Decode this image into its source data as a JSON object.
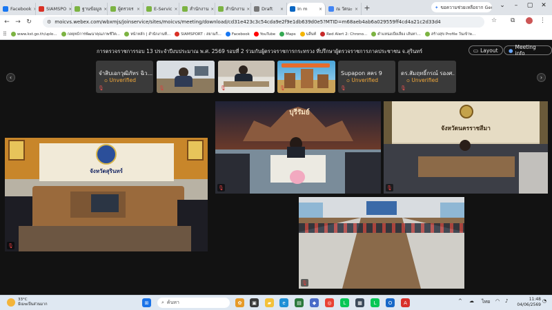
{
  "browser": {
    "tabs": [
      {
        "label": "Facebook",
        "color": "#1877f2",
        "active": false
      },
      {
        "label": "SIAMSPO",
        "color": "#d93025",
        "active": false
      },
      {
        "label": "ฐานข้อมูล",
        "color": "#7cb342",
        "active": false
      },
      {
        "label": "ผู้ตรวจร",
        "color": "#7cb342",
        "active": false
      },
      {
        "label": "E-Servic",
        "color": "#7cb342",
        "active": false
      },
      {
        "label": "สำนักงาน",
        "color": "#7cb342",
        "active": false
      },
      {
        "label": "สำนักงาน",
        "color": "#7cb342",
        "active": false
      },
      {
        "label": "Draft",
        "color": "#777777",
        "active": false
      },
      {
        "label": "In m",
        "color": "#0a66c2",
        "active": true
      },
      {
        "label": "ณ วัดนะ",
        "color": "#4285f4",
        "active": false
      }
    ],
    "gemini_label": "ขอความช่วยเหลือจาก Gemini",
    "url": "moicvs.webex.com/wbxmjs/joinservice/sites/moicvs/meeting/download/cd31e423c3c54cda9e2f9e1db639d0e5?MTID=m68aeb4ab6a029559ff4cd4a21c2d33d4",
    "bookmarks": [
      {
        "label": "www.kst.go.th/uplo...",
        "color": "#7cb342"
      },
      {
        "label": "กลยุทธ์การพัฒนาคุณภาพชีวิต...",
        "color": "#7cb342"
      },
      {
        "label": "หน้าหลัก | สำนักงานที่...",
        "color": "#7cb342"
      },
      {
        "label": "SIAMSPORT : สยามกี...",
        "color": "#d93025"
      },
      {
        "label": "Facebook",
        "color": "#1877f2"
      },
      {
        "label": "YouTube",
        "color": "#ff0000"
      },
      {
        "label": "Maps",
        "color": "#34a853"
      },
      {
        "label": "นลิ้นท์",
        "color": "#f4b400"
      },
      {
        "label": "Red Alert 2: Chrono...",
        "color": "#c62828"
      },
      {
        "label": "ตำแหน่งเบี้ยเลี้ยง เส้นทา...",
        "color": "#7cb342"
      },
      {
        "label": "สร้างสุข Profile วันเข้าพ...",
        "color": "#7cb342"
      }
    ]
  },
  "meeting": {
    "title": "การตรวจราชการรอบ 13 ประจำปีงบประมาณ พ.ศ. 2569 รอบที่ 2 ร่วมกับผู้ตรวจราชการกระทรวง ที่ปรึกษาผู้ตรวจราชการภาคประชาชน จ.สุรินทร์",
    "layout_label": "Layout",
    "meeting_info_label": "Meeting info",
    "thumbnails": [
      {
        "name": "จำสิบเอกวุฒิภัทร ฉิว...",
        "status": "Unverified",
        "type": "name"
      },
      {
        "name": "",
        "status": "",
        "type": "video"
      },
      {
        "name": "",
        "status": "",
        "type": "video"
      },
      {
        "name": "",
        "status": "",
        "type": "video"
      },
      {
        "name": "Supapon สคร 9",
        "status": "Unverified",
        "type": "name"
      },
      {
        "name": "ดร.สัมฤทธิ์กรณ์ รองศ...",
        "status": "Unverified",
        "type": "name"
      }
    ],
    "tiles": [
      {
        "sign": "จังหวัดสุรินทร์"
      },
      {
        "sign": "บุรีรัมย์"
      },
      {
        "sign": "จังหวัดนครราชสีมา"
      },
      {
        "sign": ""
      }
    ]
  },
  "taskbar": {
    "weather_temp": "33°C",
    "weather_desc": "มีเมฆเป็นส่วนมาก",
    "search_placeholder": "ค้นหา",
    "language": "ไทย",
    "time": "11:48",
    "date": "04/06/2569"
  }
}
